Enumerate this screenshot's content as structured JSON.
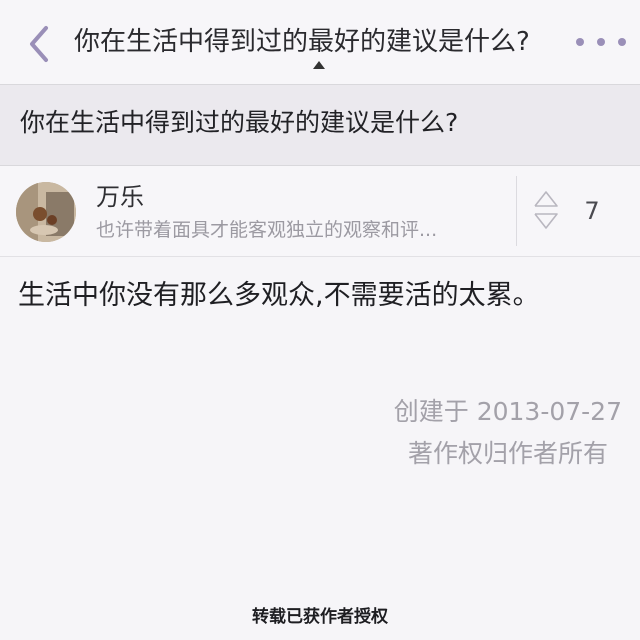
{
  "navbar": {
    "title": "你在生活中得到过的最好的建议是什么?",
    "back_icon": "chevron-left-icon",
    "more_icon": "more-dots-icon",
    "accent_color": "#9a8fb8"
  },
  "question": {
    "title": "你在生活中得到过的最好的建议是什么?"
  },
  "answer": {
    "author_name": "万乐",
    "author_bio": "也许带着面具才能客观独立的观察和评...",
    "vote_count": "7",
    "vote_icon": "vote-arrows-icon",
    "content": "生活中你没有那么多观众,不需要活的太累。",
    "created": "创建于 2013-07-27",
    "copyright": "著作权归作者所有"
  },
  "footer": {
    "repost_note": "转载已获作者授权"
  }
}
